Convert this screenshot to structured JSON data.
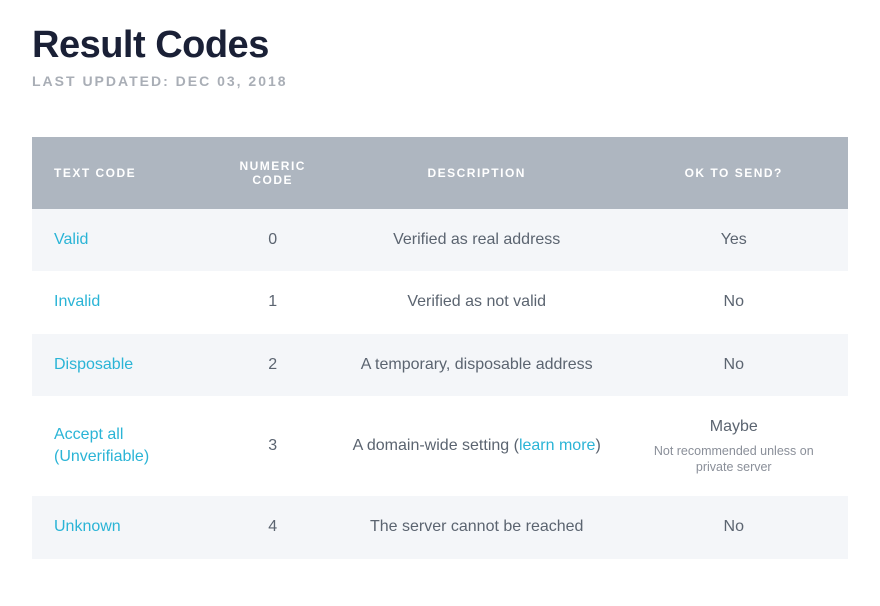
{
  "page": {
    "title": "Result Codes",
    "last_updated_label": "LAST UPDATED:",
    "last_updated_date": "DEC 03, 2018"
  },
  "table": {
    "headers": {
      "text_code": "TEXT CODE",
      "numeric_code": "NUMERIC CODE",
      "description": "DESCRIPTION",
      "ok_to_send": "OK TO SEND?"
    },
    "rows": [
      {
        "text_code": "Valid",
        "numeric_code": "0",
        "description_prefix": "Verified as real address",
        "description_link": "",
        "description_suffix": "",
        "ok_to_send": "Yes",
        "ok_note": ""
      },
      {
        "text_code": "Invalid",
        "numeric_code": "1",
        "description_prefix": "Verified as not valid",
        "description_link": "",
        "description_suffix": "",
        "ok_to_send": "No",
        "ok_note": ""
      },
      {
        "text_code": "Disposable",
        "numeric_code": "2",
        "description_prefix": "A temporary, disposable address",
        "description_link": "",
        "description_suffix": "",
        "ok_to_send": "No",
        "ok_note": ""
      },
      {
        "text_code": "Accept all (Unverifiable)",
        "numeric_code": "3",
        "description_prefix": "A domain-wide setting (",
        "description_link": "learn more",
        "description_suffix": ")",
        "ok_to_send": "Maybe",
        "ok_note": "Not recommended unless on private server"
      },
      {
        "text_code": "Unknown",
        "numeric_code": "4",
        "description_prefix": "The server cannot be reached",
        "description_link": "",
        "description_suffix": "",
        "ok_to_send": "No",
        "ok_note": ""
      }
    ]
  }
}
